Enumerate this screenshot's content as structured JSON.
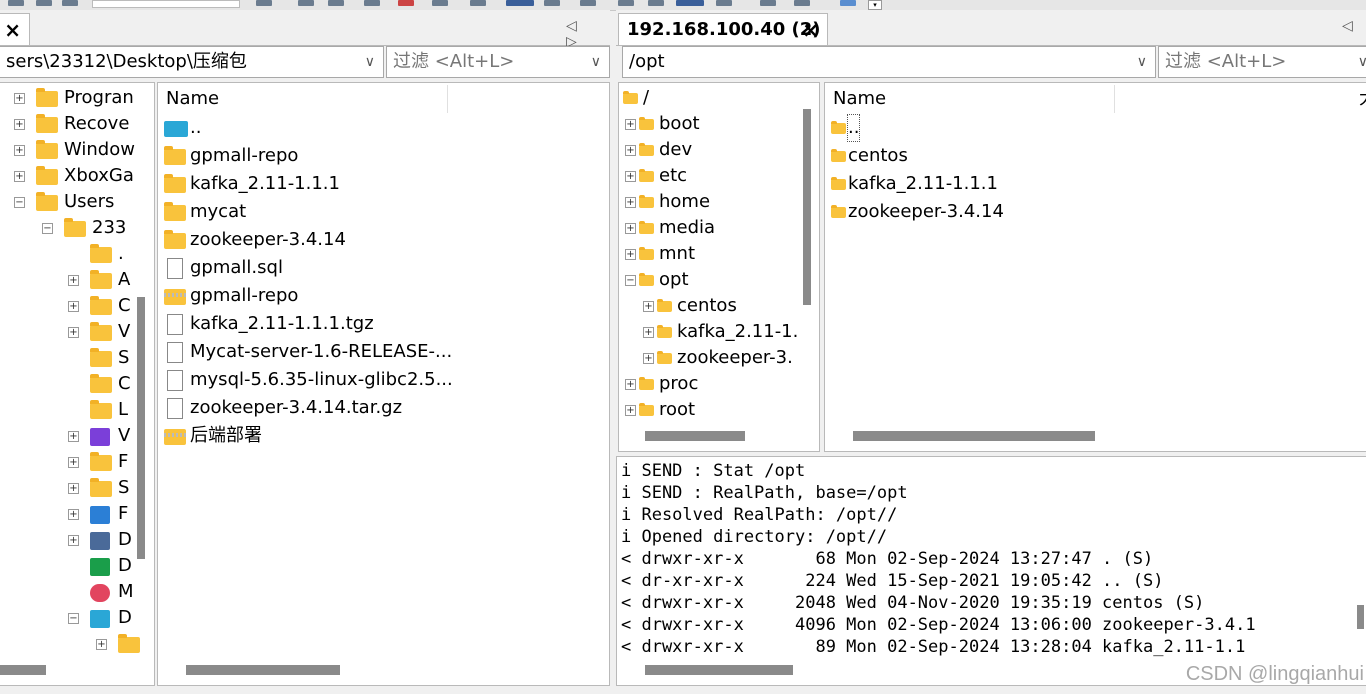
{
  "left_tab": {
    "close": "×"
  },
  "right_tab": {
    "title": "192.168.100.40 (2)",
    "close": "×"
  },
  "nav_arrows": "◁ ▷",
  "left_path": {
    "value": "sers\\23312\\Desktop\\压缩包",
    "filter_placeholder": "过滤 <Alt+L>"
  },
  "right_path": {
    "value": "/opt",
    "filter_placeholder": "过滤 <Alt+L>"
  },
  "left_tree": [
    {
      "label": "Progran",
      "level": 0,
      "expander": "+"
    },
    {
      "label": "Recove",
      "level": 0,
      "expander": "+"
    },
    {
      "label": "Window",
      "level": 0,
      "expander": "+"
    },
    {
      "label": "XboxGa",
      "level": 0,
      "expander": "+"
    },
    {
      "label": "Users",
      "level": 0,
      "expander": "-"
    },
    {
      "label": "233",
      "level": 1,
      "expander": "-"
    },
    {
      "label": ".",
      "level": 2,
      "expander": ""
    },
    {
      "label": "A",
      "level": 2,
      "expander": "+"
    },
    {
      "label": "C",
      "level": 2,
      "expander": "+"
    },
    {
      "label": "V",
      "level": 2,
      "expander": "+"
    },
    {
      "label": "S",
      "level": 2,
      "expander": ""
    },
    {
      "label": "C",
      "level": 2,
      "expander": ""
    },
    {
      "label": "L",
      "level": 2,
      "expander": ""
    },
    {
      "label": "V",
      "level": 2,
      "expander": "+"
    },
    {
      "label": "F",
      "level": 2,
      "expander": "+"
    },
    {
      "label": "S",
      "level": 2,
      "expander": "+"
    },
    {
      "label": "F",
      "level": 2,
      "expander": "+"
    },
    {
      "label": "D",
      "level": 2,
      "expander": "+"
    },
    {
      "label": "D",
      "level": 2,
      "expander": ""
    },
    {
      "label": "M",
      "level": 2,
      "expander": ""
    },
    {
      "label": "D",
      "level": 2,
      "expander": "-"
    },
    {
      "label": "",
      "level": 3,
      "expander": "+"
    }
  ],
  "left_list": {
    "column": "Name",
    "items": [
      {
        "name": "..",
        "icon": "updir-icon"
      },
      {
        "name": "gpmall-repo",
        "icon": "folder-icon"
      },
      {
        "name": "kafka_2.11-1.1.1",
        "icon": "folder-icon"
      },
      {
        "name": "mycat",
        "icon": "folder-icon"
      },
      {
        "name": "zookeeper-3.4.14",
        "icon": "folder-icon"
      },
      {
        "name": "gpmall.sql",
        "icon": "file-icon"
      },
      {
        "name": "gpmall-repo",
        "icon": "zip-folder-icon"
      },
      {
        "name": "kafka_2.11-1.1.1.tgz",
        "icon": "file-icon"
      },
      {
        "name": "Mycat-server-1.6-RELEASE-...",
        "icon": "file-icon"
      },
      {
        "name": "mysql-5.6.35-linux-glibc2.5...",
        "icon": "file-icon"
      },
      {
        "name": "zookeeper-3.4.14.tar.gz",
        "icon": "file-icon"
      },
      {
        "name": "后端部署",
        "icon": "zip-folder-icon"
      }
    ]
  },
  "right_tree": [
    {
      "label": "/",
      "level": 0,
      "expander": ""
    },
    {
      "label": "boot",
      "level": 0,
      "expander": "+"
    },
    {
      "label": "dev",
      "level": 0,
      "expander": "+"
    },
    {
      "label": "etc",
      "level": 0,
      "expander": "+"
    },
    {
      "label": "home",
      "level": 0,
      "expander": "+"
    },
    {
      "label": "media",
      "level": 0,
      "expander": "+"
    },
    {
      "label": "mnt",
      "level": 0,
      "expander": "+"
    },
    {
      "label": "opt",
      "level": 0,
      "expander": "-"
    },
    {
      "label": "centos",
      "level": 1,
      "expander": "+"
    },
    {
      "label": "kafka_2.11-1.",
      "level": 1,
      "expander": "+"
    },
    {
      "label": "zookeeper-3.",
      "level": 1,
      "expander": "+"
    },
    {
      "label": "proc",
      "level": 0,
      "expander": "+"
    },
    {
      "label": "root",
      "level": 0,
      "expander": "+"
    }
  ],
  "right_list": {
    "column": "Name",
    "column2_fragment": "大",
    "items": [
      {
        "name": ".."
      },
      {
        "name": "centos"
      },
      {
        "name": "kafka_2.11-1.1.1"
      },
      {
        "name": "zookeeper-3.4.14"
      }
    ]
  },
  "log": [
    "i SEND : Stat /opt",
    "i SEND : RealPath, base=/opt",
    "i Resolved RealPath: /opt//",
    "i Opened directory: /opt//",
    "< drwxr-xr-x       68 Mon 02-Sep-2024 13:27:47 . (S)",
    "< dr-xr-xr-x      224 Wed 15-Sep-2021 19:05:42 .. (S)",
    "< drwxr-xr-x     2048 Wed 04-Nov-2020 19:35:19 centos (S)",
    "< drwxr-xr-x     4096 Mon 02-Sep-2024 13:06:00 zookeeper-3.4.1",
    "< drwxr-xr-x       89 Mon 02-Sep-2024 13:28:04 kafka_2.11-1.1"
  ],
  "watermark": "CSDN @lingqianhui"
}
